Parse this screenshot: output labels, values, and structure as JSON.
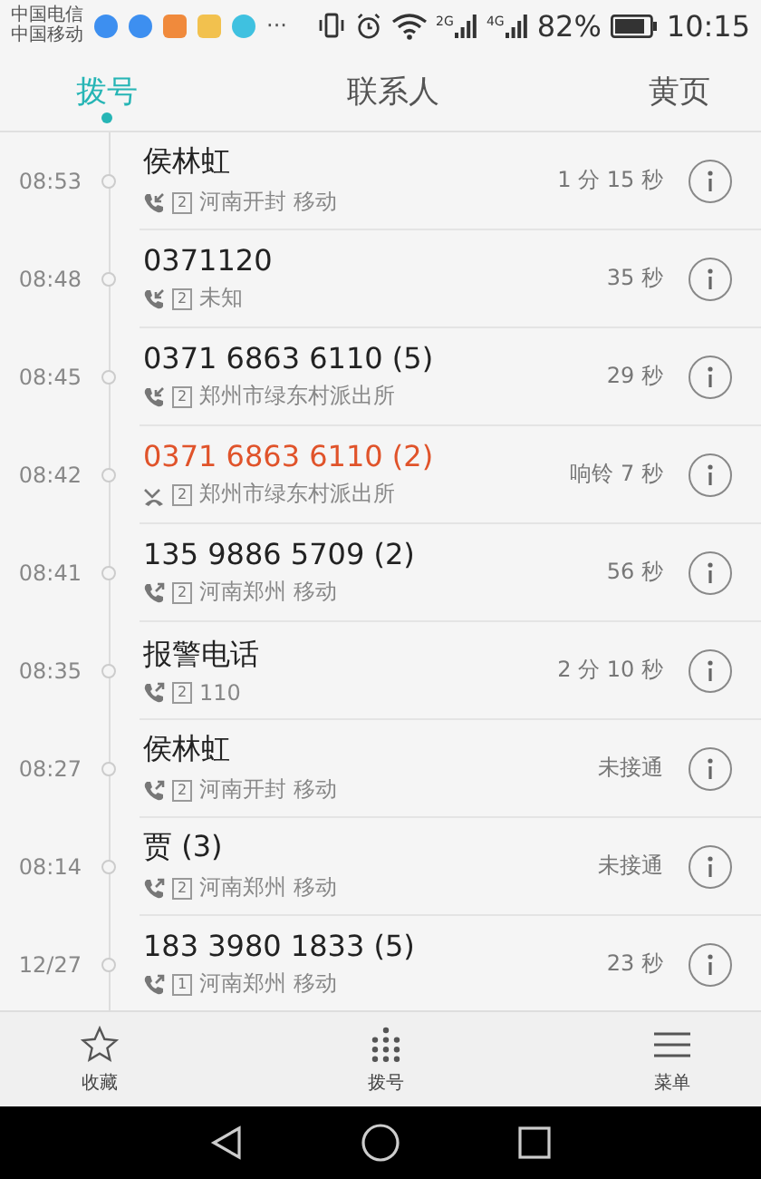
{
  "status_bar": {
    "carriers": [
      "中国电信",
      "中国移动"
    ],
    "more": "···",
    "signal_labels": [
      "2G",
      "4G"
    ],
    "battery": "82%",
    "time": "10:15"
  },
  "tabs": [
    {
      "label": "拨号",
      "selected": true
    },
    {
      "label": "联系人",
      "selected": false
    },
    {
      "label": "黄页",
      "selected": false
    }
  ],
  "calls": [
    {
      "time": "08:53",
      "name": "侯林虹",
      "kind": "incoming",
      "sim": "2",
      "location": "河南开封 移动",
      "duration": "1 分 15 秒"
    },
    {
      "time": "08:48",
      "name": "0371120",
      "kind": "incoming",
      "sim": "2",
      "location": "未知",
      "duration": "35 秒"
    },
    {
      "time": "08:45",
      "name": "0371 6863 6110 (5)",
      "kind": "incoming",
      "sim": "2",
      "location": "郑州市绿东村派出所",
      "duration": "29 秒"
    },
    {
      "time": "08:42",
      "name": "0371 6863 6110 (2)",
      "kind": "missed",
      "sim": "2",
      "location": "郑州市绿东村派出所",
      "duration": "响铃 7 秒"
    },
    {
      "time": "08:41",
      "name": "135 9886 5709 (2)",
      "kind": "outgoing",
      "sim": "2",
      "location": "河南郑州 移动",
      "duration": "56 秒"
    },
    {
      "time": "08:35",
      "name": "报警电话",
      "kind": "outgoing",
      "sim": "2",
      "location": "110",
      "duration": "2 分 10 秒"
    },
    {
      "time": "08:27",
      "name": "侯林虹",
      "kind": "outgoing",
      "sim": "2",
      "location": "河南开封 移动",
      "duration": "未接通"
    },
    {
      "time": "08:14",
      "name": "贾 (3)",
      "kind": "outgoing",
      "sim": "2",
      "location": "河南郑州 移动",
      "duration": "未接通"
    },
    {
      "time": "12/27",
      "name": "183 3980 1833 (5)",
      "kind": "outgoing",
      "sim": "1",
      "location": "河南郑州 移动",
      "duration": "23 秒"
    }
  ],
  "bottom_bar": [
    {
      "label": "收藏",
      "kind": "star"
    },
    {
      "label": "拨号",
      "kind": "dialpad"
    },
    {
      "label": "菜单",
      "kind": "menu"
    }
  ]
}
